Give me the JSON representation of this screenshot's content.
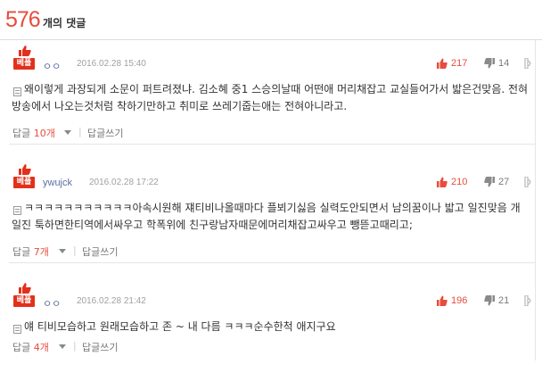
{
  "header": {
    "count": "576",
    "label": "개의 댓글"
  },
  "comments": [
    {
      "badge": "베플",
      "author": "ㅇㅇ",
      "date": "2016.02.28 15:40",
      "likes": "217",
      "dislikes": "14",
      "text": "왜이렇게 과장되게 소문이 퍼트려졌냐. 김소혜 중1 스승의날때 어떤애 머리채잡고 교실들어가서 밟은건맞음. 전혀 방송에서 나오는것처럼 착하기만하고 취미로 쓰레기줍는애는 전혀아니라고.",
      "reply_label": "답글 ",
      "reply_count": "10개",
      "write_label": "답글쓰기"
    },
    {
      "badge": "베플",
      "author": "ywujck",
      "date": "2016.02.28 17:22",
      "likes": "210",
      "dislikes": "27",
      "text": "ㅋㅋㅋㅋㅋㅋㅋㅋㅋㅋㅋ아속시원해 쟤티비나올때마다 플뵈기싫음 실력도안되면서 남의꿈이나 밟고 일진맞음 개일진 툭하면한티역에서싸우고 학폭위에 친구랑남자때문에머리채잡고싸우고 뺑뜯고때리고;",
      "reply_label": "답글 ",
      "reply_count": "7개",
      "write_label": "답글쓰기"
    },
    {
      "badge": "베플",
      "author": "ㅇㅇ",
      "date": "2016.02.28 21:42",
      "likes": "196",
      "dislikes": "21",
      "text": "얘 티비모습하고 원래모습하고 존 ~ 내 다름 ㅋㅋㅋ순수한척 애지구요",
      "reply_label": "답글 ",
      "reply_count": "4개",
      "write_label": "답글쓰기"
    }
  ],
  "colors": {
    "accent": "#e84c3d",
    "badge": "#e3301b",
    "author": "#5a6fa0"
  },
  "icons": [
    "thumbs-up-icon",
    "like-icon",
    "dislike-icon",
    "more-icon",
    "text-icon"
  ]
}
